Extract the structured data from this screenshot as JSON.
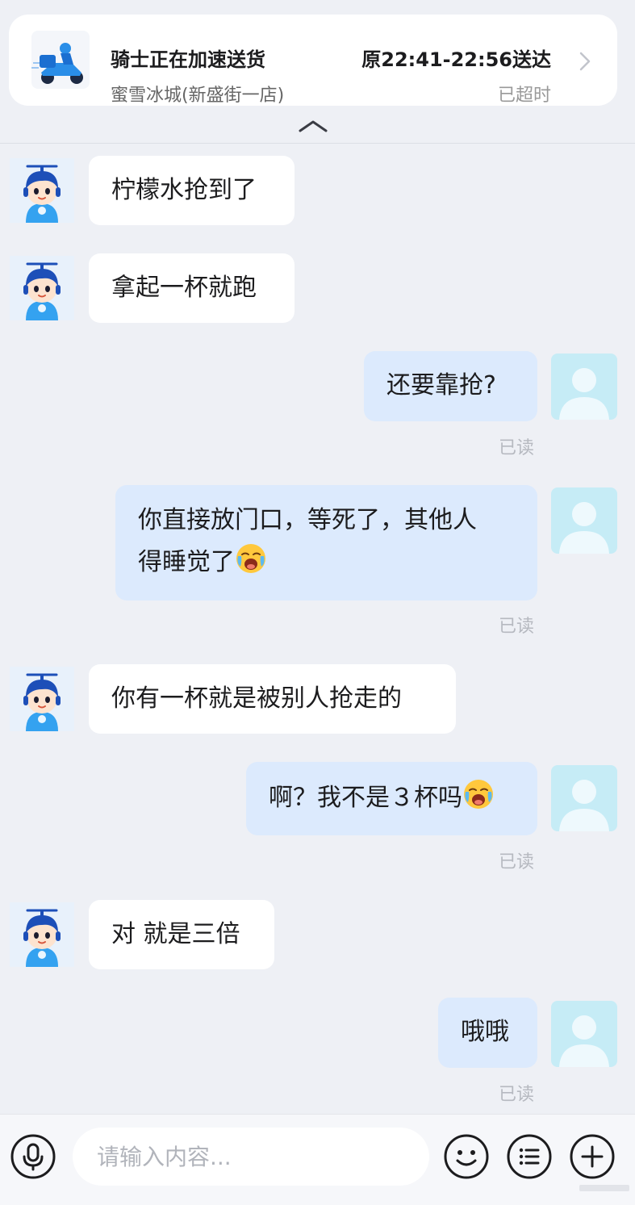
{
  "order": {
    "status": "骑士正在加速送货",
    "time": "原22:41-22:56送达",
    "shop": "蜜雪冰城(新盛街一店)",
    "overdue": "已超时",
    "rider_icon": "delivery-scooter-icon"
  },
  "messages": [
    {
      "side": "in",
      "text": "柠檬水抢到了"
    },
    {
      "side": "in",
      "text": "拿起一杯就跑"
    },
    {
      "side": "out",
      "text": "还要靠抢?",
      "read": "已读"
    },
    {
      "side": "out",
      "line1": "你直接放门口，等死了，其他人",
      "line2": "得睡觉了",
      "emoji": "crying-face-icon",
      "read": "已读"
    },
    {
      "side": "in",
      "text": "你有一杯就是被别人抢走的"
    },
    {
      "side": "out",
      "text": "啊？我不是３杯吗",
      "emoji": "crying-face-icon",
      "read": "已读"
    },
    {
      "side": "in",
      "text": "对 就是三倍"
    },
    {
      "side": "out",
      "text": "哦哦",
      "read": "已读"
    }
  ],
  "input": {
    "placeholder": "请输入内容..."
  },
  "icons": {
    "voice": "microphone-icon",
    "emoji": "smiley-icon",
    "menu": "list-icon",
    "plus": "plus-icon"
  },
  "colors": {
    "background": "#eef0f5",
    "incoming_bubble": "#ffffff",
    "outgoing_bubble": "#dceafd",
    "read_text": "#b6b9c0",
    "avatar_blue": "#2a8ee8"
  }
}
